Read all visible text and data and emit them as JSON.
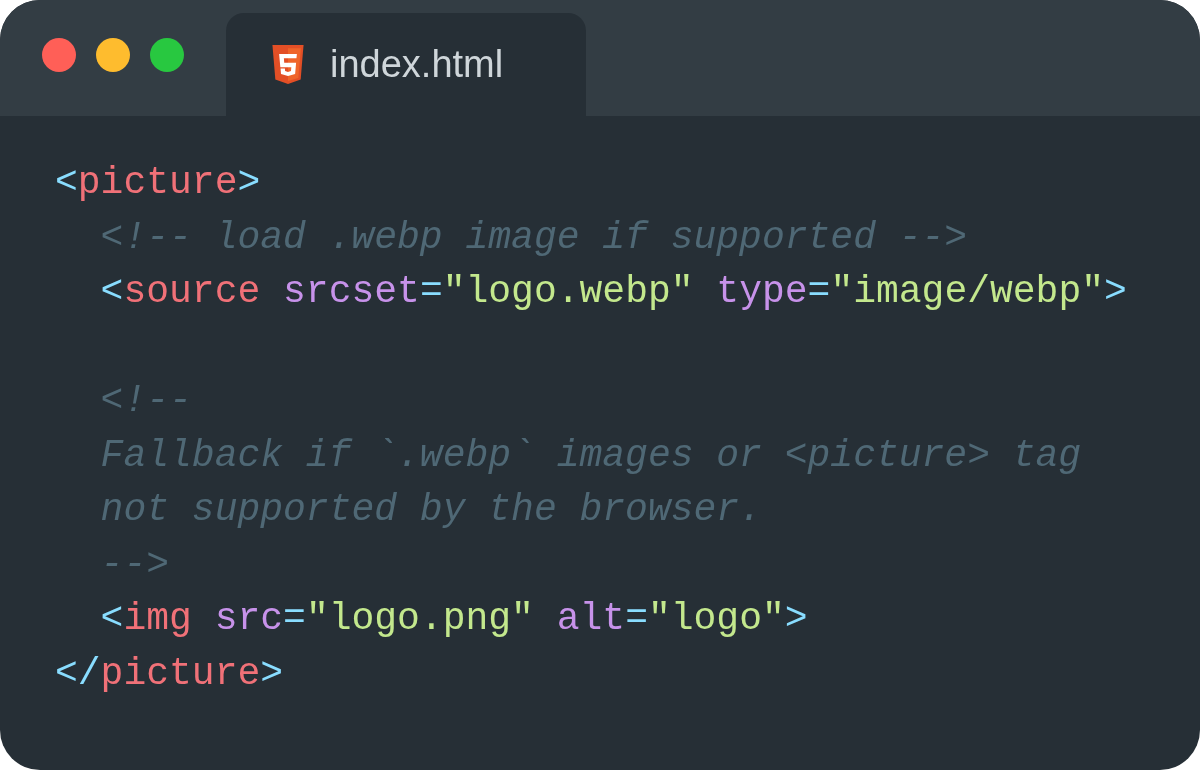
{
  "window": {
    "controls": [
      {
        "color": "#ff5f57"
      },
      {
        "color": "#febc2e"
      },
      {
        "color": "#28c840"
      }
    ]
  },
  "tab": {
    "label": "index.html",
    "selected": true
  },
  "code": [
    {
      "kind": "code",
      "tokens": [
        {
          "kind": "punct",
          "s": "<"
        },
        {
          "kind": "tag",
          "s": "picture"
        },
        {
          "kind": "punct",
          "s": ">"
        }
      ]
    },
    {
      "kind": "code",
      "tokens": [
        {
          "kind": "comment",
          "s": "  <!-- load .webp image if supported -->"
        }
      ]
    },
    {
      "kind": "code",
      "tokens": [
        {
          "kind": "punct",
          "s": "  <"
        },
        {
          "kind": "tag",
          "s": "source"
        },
        {
          "kind": "attr",
          "s": " srcset"
        },
        {
          "kind": "punct",
          "s": "="
        },
        {
          "kind": "string",
          "s": "\"logo.webp\""
        },
        {
          "kind": "attr",
          "s": " type"
        },
        {
          "kind": "punct",
          "s": "="
        },
        {
          "kind": "string",
          "s": "\"image/webp\""
        },
        {
          "kind": "punct",
          "s": ">"
        }
      ]
    },
    {
      "kind": "blank"
    },
    {
      "kind": "code",
      "tokens": [
        {
          "kind": "comment",
          "s": "  <!--"
        }
      ]
    },
    {
      "kind": "code",
      "tokens": [
        {
          "kind": "comment",
          "s": "  Fallback if `.webp` images or <picture> tag"
        }
      ]
    },
    {
      "kind": "code",
      "tokens": [
        {
          "kind": "comment",
          "s": "  not supported by the browser."
        }
      ]
    },
    {
      "kind": "code",
      "tokens": [
        {
          "kind": "comment",
          "s": "  -->"
        }
      ]
    },
    {
      "kind": "code",
      "tokens": [
        {
          "kind": "punct",
          "s": "  <"
        },
        {
          "kind": "tag",
          "s": "img"
        },
        {
          "kind": "attr",
          "s": " src"
        },
        {
          "kind": "punct",
          "s": "="
        },
        {
          "kind": "string",
          "s": "\"logo.png\""
        },
        {
          "kind": "attr",
          "s": " alt"
        },
        {
          "kind": "punct",
          "s": "="
        },
        {
          "kind": "string",
          "s": "\"logo\""
        },
        {
          "kind": "punct",
          "s": ">"
        }
      ]
    },
    {
      "kind": "code",
      "tokens": [
        {
          "kind": "punct",
          "s": "</"
        },
        {
          "kind": "tag",
          "s": "picture"
        },
        {
          "kind": "punct",
          "s": ">"
        }
      ]
    }
  ]
}
